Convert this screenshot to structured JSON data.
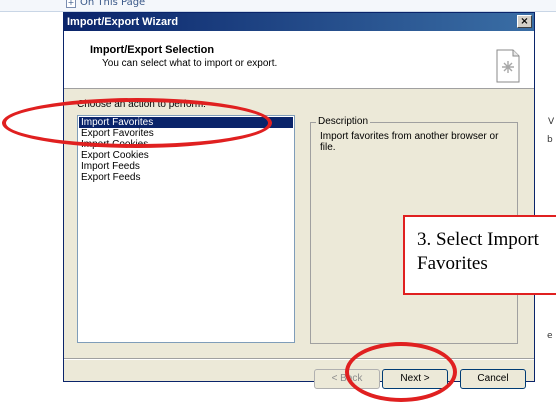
{
  "background": {
    "link_text": "On This Page",
    "frag_v": "V",
    "frag_b": "b",
    "frag_e": "e"
  },
  "window": {
    "title": "Import/Export Wizard",
    "close_glyph": "×"
  },
  "header": {
    "title": "Import/Export Selection",
    "subtitle": "You can select what to import or export."
  },
  "actions": {
    "label": "Choose an action to perform:",
    "items": [
      {
        "label": "Import Favorites",
        "selected": true
      },
      {
        "label": "Export Favorites",
        "selected": false
      },
      {
        "label": "Import Cookies",
        "selected": false
      },
      {
        "label": "Export Cookies",
        "selected": false
      },
      {
        "label": "Import Feeds",
        "selected": false
      },
      {
        "label": "Export Feeds",
        "selected": false
      }
    ]
  },
  "description": {
    "legend": "Description",
    "text": "Import favorites from another browser or file."
  },
  "buttons": {
    "back": "< Back",
    "next": "Next >",
    "cancel": "Cancel"
  },
  "annotation": {
    "callout_line1": "3.  Select Import",
    "callout_line2": "Favorites",
    "color": "#e02020"
  }
}
